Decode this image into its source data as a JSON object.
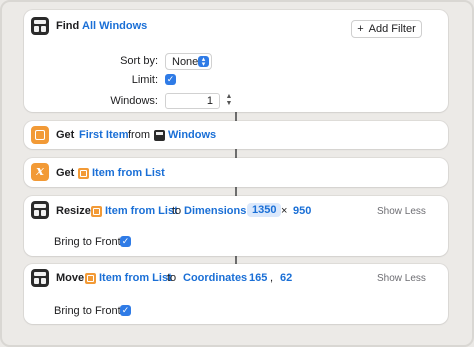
{
  "find_card": {
    "verb": "Find",
    "target": "All Windows",
    "add_filter_label": "Add Filter",
    "add_filter_icon": "plus-icon",
    "sort_by_label": "Sort by:",
    "sort_by_value": "None",
    "limit_label": "Limit:",
    "limit_checked": true,
    "windows_label": "Windows:",
    "windows_value": "1"
  },
  "get_first_card": {
    "verb": "Get",
    "item": "First Item",
    "from_label": "from",
    "source": "Windows"
  },
  "get_list_card": {
    "verb": "Get",
    "item": "Item from List"
  },
  "resize_card": {
    "verb": "Resize",
    "variable": "Item from List",
    "to_label": "to",
    "param": "Dimensions",
    "width": "1350",
    "times": "×",
    "height": "950",
    "toggle_label": "Show Less",
    "bring_label": "Bring to Front:",
    "bring_checked": true
  },
  "move_card": {
    "verb": "Move",
    "variable": "Item from List",
    "to_label": "to",
    "param": "Coordinates",
    "x": "165",
    "comma": ",",
    "y": "62",
    "toggle_label": "Show Less",
    "bring_label": "Bring to Front:",
    "bring_checked": true
  },
  "colors": {
    "accent": "#1a6fd6",
    "icon_orange": "#f29a36",
    "icon_dark": "#2a2a2a",
    "checkbox": "#2f7be6"
  }
}
